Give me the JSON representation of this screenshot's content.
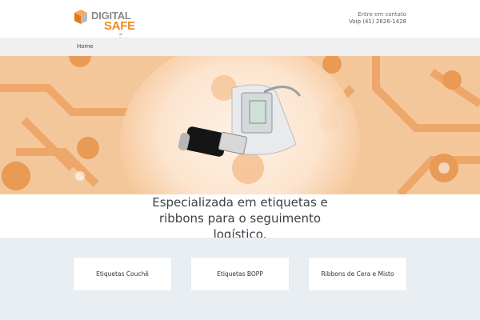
{
  "logo": {
    "word1": "DIGITAL",
    "word2": "SAFE",
    "word3": "do Brasil"
  },
  "contact": {
    "line1": "Entre em contato",
    "line2": "Voip (41) 2626-1428"
  },
  "nav": {
    "home": "Home"
  },
  "hero": {
    "image": "usb-biometric-reader-photo"
  },
  "tagline": {
    "line1": "Especializada em etiquetas e",
    "line2": "ribbons para o seguimento",
    "line3": "logístico."
  },
  "cards": [
    {
      "label": "Etiquetas Couchê"
    },
    {
      "label": "Etiquetas BOPP"
    },
    {
      "label": "Ribbons de Cera e Misto"
    }
  ],
  "colors": {
    "brand_orange": "#f08a1c",
    "nav_bg": "#f0f0f0",
    "section_bg": "#e9eef2"
  }
}
